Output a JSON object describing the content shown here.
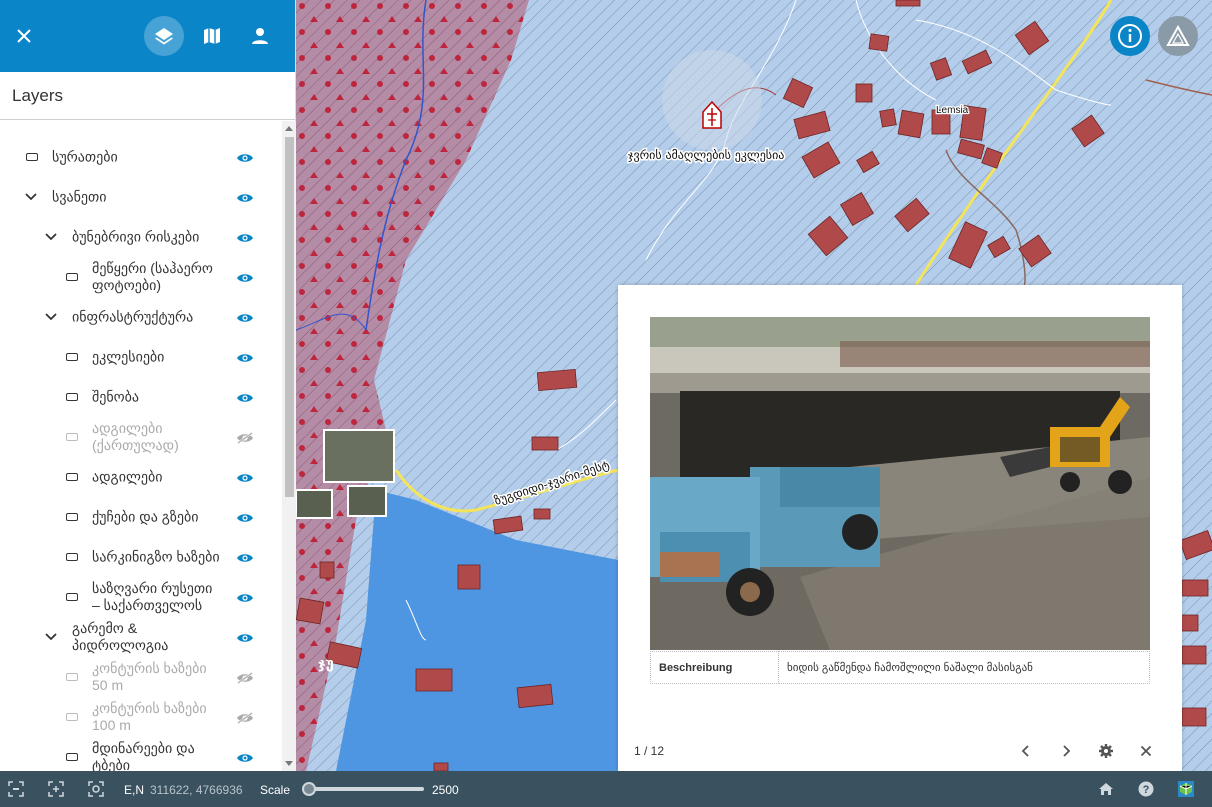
{
  "sidebar": {
    "title": "Layers",
    "header_buttons": [
      "close-icon",
      "layers-icon",
      "map-icon",
      "person-icon"
    ],
    "layers": [
      {
        "label": "სურათები",
        "level": 0,
        "type": "layer",
        "visible": true
      },
      {
        "label": "სვანეთი",
        "level": 0,
        "type": "group",
        "visible": true
      },
      {
        "label": "ბუნებრივი რისკები",
        "level": 1,
        "type": "group",
        "visible": true
      },
      {
        "label": "მეწყერი (საჰაერო ფოტოები)",
        "level": 2,
        "type": "layer",
        "visible": true
      },
      {
        "label": "ინფრასტრუქტურა",
        "level": 1,
        "type": "group",
        "visible": true
      },
      {
        "label": "ეკლესიები",
        "level": 2,
        "type": "layer",
        "visible": true
      },
      {
        "label": "შენობა",
        "level": 2,
        "type": "layer",
        "visible": true
      },
      {
        "label": "ადგილები (ქართულად)",
        "level": 2,
        "type": "layer",
        "visible": false
      },
      {
        "label": "ადგილები",
        "level": 2,
        "type": "layer",
        "visible": true
      },
      {
        "label": "ქუჩები და გზები",
        "level": 2,
        "type": "layer",
        "visible": true
      },
      {
        "label": "სარკინიგზო ხაზები",
        "level": 2,
        "type": "layer",
        "visible": true
      },
      {
        "label": "საზღვარი რუსეთი – საქართველოს",
        "level": 2,
        "type": "layer",
        "visible": true
      },
      {
        "label": "გარემო & პიდროლოგია",
        "level": 1,
        "type": "group",
        "visible": true
      },
      {
        "label": "კონტურის ხაზები 50 m",
        "level": 2,
        "type": "layer",
        "visible": false
      },
      {
        "label": "კონტურის ხაზები 100 m",
        "level": 2,
        "type": "layer",
        "visible": false
      },
      {
        "label": "მდინარეები და ტბები",
        "level": 2,
        "type": "layer",
        "visible": true
      }
    ]
  },
  "map": {
    "church_label": "ჯვრის ამაღლების ეკლესია",
    "place_label": "Lemsia",
    "road_label": "ზუგდიდი-ჯვარი-მესტ",
    "partial_label": "ჯუ"
  },
  "popup": {
    "attribute_key": "Beschreibung",
    "attribute_value": "ხიდის გაწმენდა ჩამოშლილი ნაშალი მასისგან",
    "page_count": "1 / 12"
  },
  "statusbar": {
    "coord_label": "E,N",
    "coords": "311622, 4766936",
    "scale_label": "Scale",
    "scale_value": "2500"
  },
  "colors": {
    "header_blue": "#0a85c7",
    "eye_blue": "#0a85c7",
    "bottom_bar": "#3a5260",
    "building_red": "#b04a4a",
    "water_blue": "#4f96e2"
  }
}
